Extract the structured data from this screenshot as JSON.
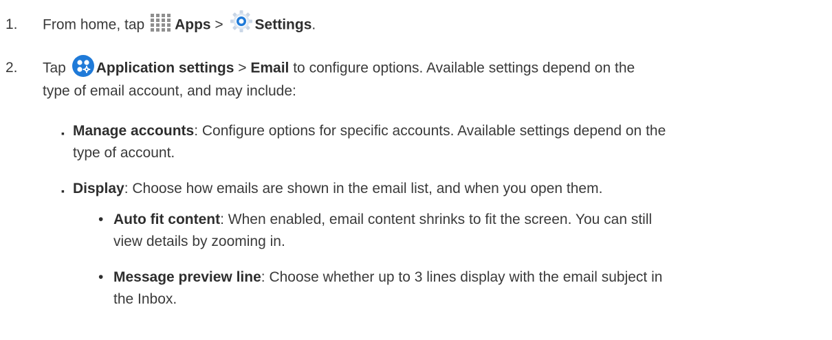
{
  "step1": {
    "number": "1.",
    "from": "From home, tap",
    "apps_icon": "apps-grid-icon",
    "apps": "Apps",
    "sep": ">",
    "settings_icon": "settings-gear-icon",
    "settings": "Settings",
    "end": "."
  },
  "step2": {
    "number": "2.",
    "tap": "Tap",
    "app_icon": "application-settings-icon",
    "app_settings": "Application settings",
    "sep": ">",
    "email": "Email",
    "rest_line1": "to configure options. Available settings depend on the",
    "rest_line2": "type of email account, and may include:"
  },
  "bullets": [
    {
      "marker": "▪",
      "term": "Manage accounts",
      "line1": ": Configure options for specific accounts. Available settings depend on the",
      "line2": "type of account."
    },
    {
      "marker": "▪",
      "term": "Display",
      "line1": ": Choose how emails are shown in the email list, and when you open them."
    }
  ],
  "subbullets": [
    {
      "marker": "•",
      "term": "Auto fit content",
      "line1": ": When enabled, email content shrinks to fit the screen. You can still",
      "line2": "view details by zooming in."
    },
    {
      "marker": "•",
      "term": "Message preview line",
      "line1": ": Choose whether up to 3 lines display with the email subject in",
      "line2": "the Inbox."
    }
  ],
  "colors": {
    "text": "#3a3a3a",
    "icon_blue": "#1f7ad8",
    "apps_gray": "#8f8f8f"
  }
}
